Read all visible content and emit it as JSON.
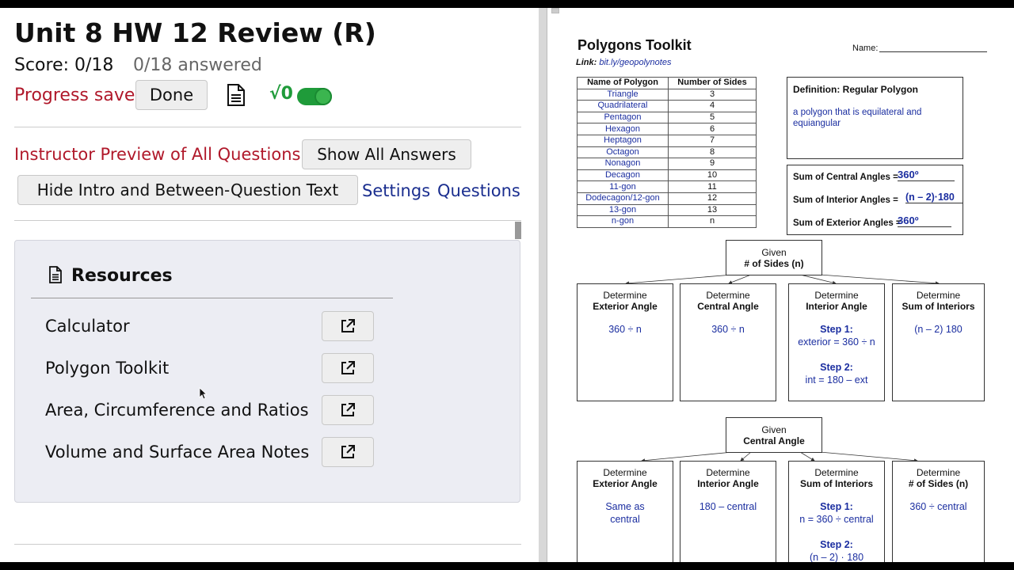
{
  "assignment": {
    "title": "Unit 8 HW 12 Review (R)",
    "score": "Score: 0/18",
    "answered": "0/18 answered",
    "progress": "Progress saved",
    "done_label": "Done",
    "sqrt_label": "√0"
  },
  "controls": {
    "preview_label": "Instructor Preview of All Questions",
    "show_answers_label": "Show All Answers",
    "hide_intro_label": "Hide Intro and Between-Question Text",
    "settings_label": "Settings",
    "questions_label": "Questions"
  },
  "resources": {
    "title": "Resources",
    "items": [
      {
        "label": "Calculator"
      },
      {
        "label": "Polygon Toolkit"
      },
      {
        "label": "Area, Circumference and Ratios"
      },
      {
        "label": "Volume and Surface Area Notes"
      }
    ]
  },
  "toolkit": {
    "title": "Polygons Toolkit",
    "link_label": "Link:",
    "link_url": "bit.ly/geopolynotes",
    "name_label": "Name:",
    "table_headers": [
      "Name of Polygon",
      "Number of Sides"
    ],
    "rows": [
      [
        "Triangle",
        "3"
      ],
      [
        "Quadrilateral",
        "4"
      ],
      [
        "Pentagon",
        "5"
      ],
      [
        "Hexagon",
        "6"
      ],
      [
        "Heptagon",
        "7"
      ],
      [
        "Octagon",
        "8"
      ],
      [
        "Nonagon",
        "9"
      ],
      [
        "Decagon",
        "10"
      ],
      [
        "11-gon",
        "11"
      ],
      [
        "Dodecagon/12-gon",
        "12"
      ],
      [
        "13-gon",
        "13"
      ],
      [
        "n-gon",
        "n"
      ]
    ],
    "definition_title": "Definition: Regular Polygon",
    "definition_text": "a polygon that is equilateral and equiangular",
    "sum_central_label": "Sum of Central Angles =",
    "sum_central_value": "360º",
    "sum_interior_label": "Sum of Interior Angles =",
    "sum_interior_value": "(n – 2)·180",
    "sum_exterior_label": "Sum of Exterior Angles =",
    "sum_exterior_value": "360º",
    "given1": {
      "line1": "Given",
      "line2": "# of Sides (n)"
    },
    "row1": [
      {
        "line1": "Determine",
        "line2": "Exterior Angle",
        "a": "360 ÷ n"
      },
      {
        "line1": "Determine",
        "line2": "Central Angle",
        "a": "360 ÷ n"
      },
      {
        "line1": "Determine",
        "line2": "Interior Angle",
        "s1": "Step 1:",
        "a1": "exterior = 360 ÷ n",
        "s2": "Step 2:",
        "a2": "int = 180 – ext"
      },
      {
        "line1": "Determine",
        "line2": "Sum of Interiors",
        "a": "(n – 2) 180"
      }
    ],
    "given2": {
      "line1": "Given",
      "line2": "Central Angle"
    },
    "row2": [
      {
        "line1": "Determine",
        "line2": "Exterior Angle",
        "a": "Same as",
        "a_b": "central"
      },
      {
        "line1": "Determine",
        "line2": "Interior Angle",
        "a": "180 – central"
      },
      {
        "line1": "Determine",
        "line2": "Sum of Interiors",
        "s1": "Step 1:",
        "a1": "n = 360 ÷ central",
        "s2": "Step 2:",
        "a2": "(n – 2) · 180"
      },
      {
        "line1": "Determine",
        "line2": "# of Sides (n)",
        "a": "360 ÷ central"
      }
    ]
  }
}
